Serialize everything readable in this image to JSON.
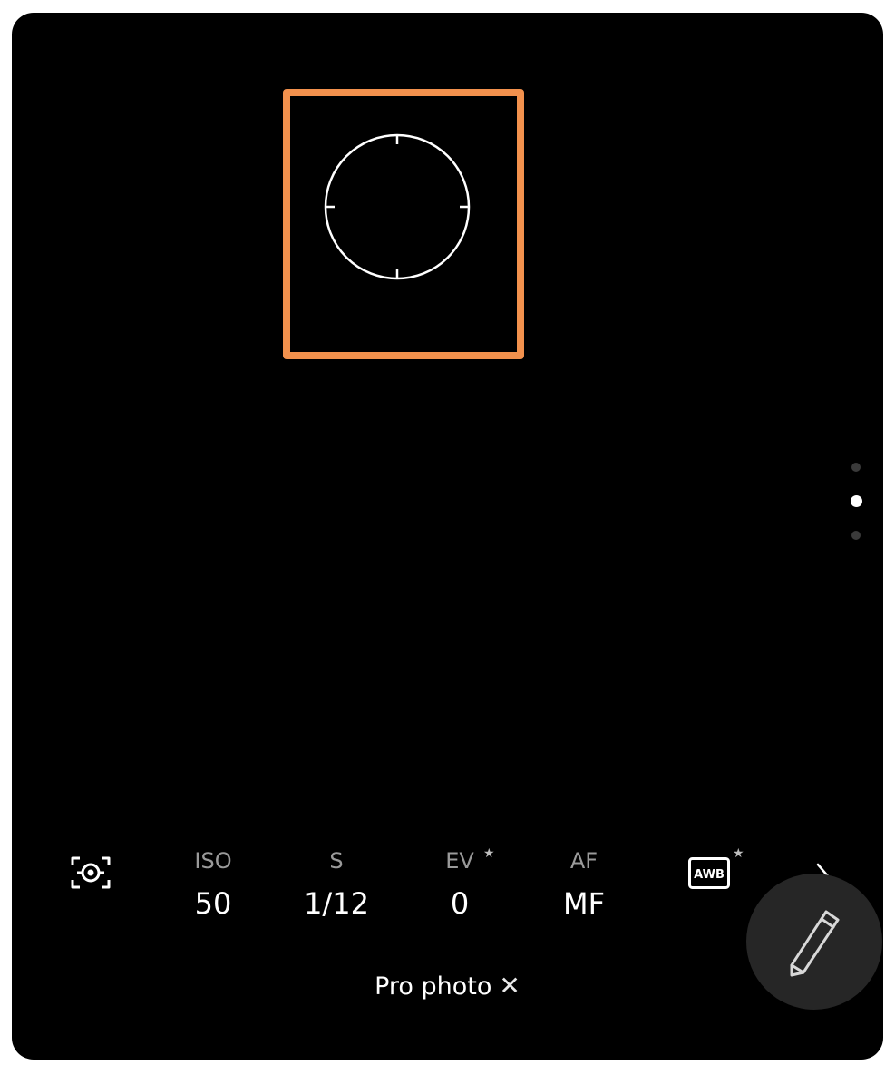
{
  "camera": {
    "focus_box_color": "#f2914d",
    "page_indicator": {
      "count": 3,
      "active_index": 1
    },
    "controls": [
      {
        "key": "metering",
        "icon": "metering-mode-icon"
      },
      {
        "key": "iso",
        "label": "ISO",
        "value": "50"
      },
      {
        "key": "shutter",
        "label": "S",
        "value": "1/12"
      },
      {
        "key": "ev",
        "label": "EV",
        "value": "0",
        "starred": true
      },
      {
        "key": "af",
        "label": "AF",
        "value": "MF"
      },
      {
        "key": "wb",
        "icon": "awb-icon",
        "icon_text": "AWB",
        "starred": true
      },
      {
        "key": "more",
        "icon": "chevron-right-icon"
      }
    ],
    "star_symbol": "★",
    "mode": {
      "label": "Pro photo",
      "close_symbol": "✕"
    },
    "fab": {
      "icon": "pencil-icon"
    }
  }
}
